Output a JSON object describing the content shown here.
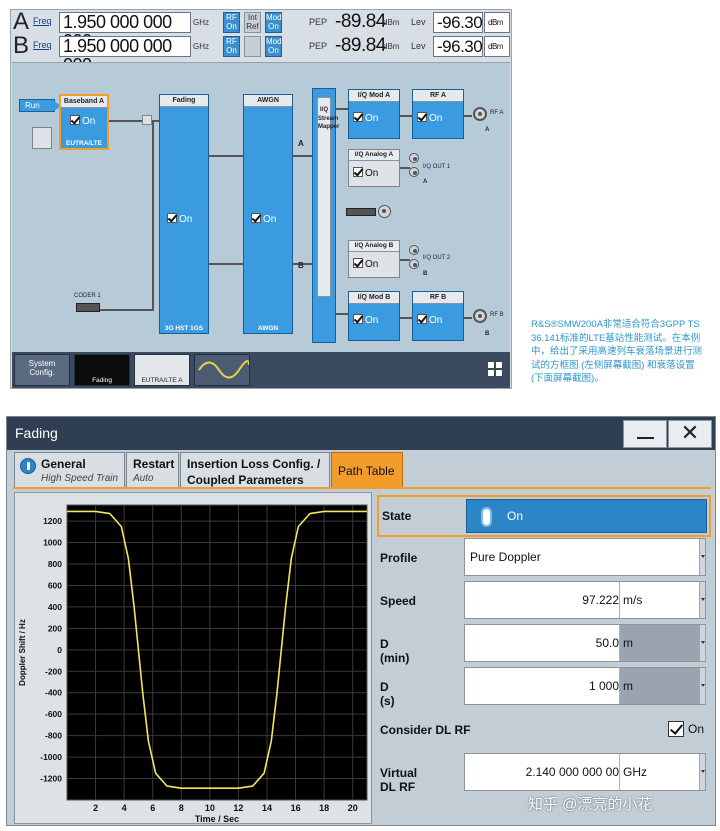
{
  "top": {
    "row_a": {
      "letter": "A",
      "freq_label": "Freq",
      "freq_value": "1.950 000 000 000",
      "freq_unit": "GHz",
      "rf_on": "RF On",
      "int_ref": "Int Ref",
      "mod_on": "Mod On",
      "pep_label": "PEP",
      "pep_value": "-89.84",
      "pep_unit": "dBm",
      "lev_label": "Lev",
      "lev_value": "-96.30",
      "lev_unit": "dBm"
    },
    "row_b": {
      "letter": "B",
      "freq_label": "Freq",
      "freq_value": "1.950 000 000 000",
      "freq_unit": "GHz",
      "rf_on": "RF On",
      "mod_on": "Mod On",
      "pep_label": "PEP",
      "pep_value": "-89.84",
      "pep_unit": "dBm",
      "lev_label": "Lev",
      "lev_value": "-96.30",
      "lev_unit": "dBm"
    },
    "diagram": {
      "run": "Run",
      "baseband": {
        "title": "Baseband A",
        "state": "On",
        "footer": "EUTRA/LTE"
      },
      "fading": {
        "title": "Fading",
        "state": "On",
        "footer": "3G HST 1GS"
      },
      "awgn": {
        "title": "AWGN",
        "state": "On",
        "footer": "AWGN"
      },
      "mapper": "I/Q Stream Mapper",
      "path_a": "A",
      "path_b": "B",
      "iq_mod_a": {
        "title": "I/Q Mod A",
        "state": "On"
      },
      "rf_a": {
        "title": "RF A",
        "state": "On",
        "port": "RF A",
        "label": "A"
      },
      "iq_analog_a": {
        "title": "I/Q Analog A",
        "state": "On",
        "port": "I/Q OUT 1",
        "label": "A"
      },
      "iq_analog_b": {
        "title": "I/Q Analog B",
        "state": "On",
        "port": "I/Q OUT 2",
        "label": "B"
      },
      "iq_mod_b": {
        "title": "I/Q Mod B",
        "state": "On"
      },
      "rf_b": {
        "title": "RF B",
        "state": "On",
        "port": "RF B",
        "label": "B"
      },
      "coder": "CODER 1"
    },
    "taskbar": {
      "system": "System Config.",
      "thumb1": "Fading",
      "thumb2": "EUTRA/LTE A"
    }
  },
  "caption": "R&S®SMW200A非常适合符合3GPP TS 36.141标准的LTE基站性能测试。在本例中，给出了采用高速列车衰落场景进行测试的方框图 (左侧屏幕截图) 和衰落设置 (下面屏幕截图)。",
  "dialog": {
    "title": "Fading",
    "tabs": [
      {
        "label": "General",
        "sub": "High Speed Train"
      },
      {
        "label": "Restart",
        "sub": "Auto"
      },
      {
        "label": "Insertion Loss Config. /",
        "sub": "Coupled Parameters"
      },
      {
        "label": "Path Table",
        "sub": ""
      }
    ],
    "params": {
      "state": {
        "label": "State",
        "value": "On"
      },
      "profile": {
        "label": "Profile",
        "value": "Pure Doppler"
      },
      "speed": {
        "label": "Speed",
        "value": "97.222",
        "unit": "m/s"
      },
      "dmin": {
        "label": "D (min)",
        "value": "50.0",
        "unit": "m"
      },
      "ds": {
        "label": "D (s)",
        "value": "1 000",
        "unit": "m"
      },
      "consider": {
        "label": "Consider DL RF",
        "value": "On"
      },
      "virtual": {
        "label": "Virtual DL RF",
        "value": "2.140 000 000 00",
        "unit": "GHz"
      }
    }
  },
  "chart_data": {
    "type": "line",
    "xlabel": "Time / Sec",
    "ylabel": "Doppler Shift / Hz",
    "xlim": [
      0,
      21
    ],
    "ylim": [
      -1400,
      1350
    ],
    "xticks": [
      2,
      4,
      6,
      8,
      10,
      12,
      14,
      16,
      18,
      20
    ],
    "yticks": [
      1200,
      1000,
      800,
      600,
      400,
      200,
      0,
      -200,
      -400,
      -600,
      -800,
      -1000,
      -1200
    ],
    "grid": true,
    "line_color": "#f2e85a",
    "background": "#000000",
    "series": [
      {
        "x": [
          0,
          2,
          3,
          3.8,
          4.3,
          4.7,
          5.0,
          5.3,
          5.7,
          6.2,
          7,
          8,
          10,
          12,
          13,
          13.8,
          14.3,
          14.7,
          15.0,
          15.3,
          15.7,
          16.2,
          17,
          18,
          20,
          21
        ],
        "y": [
          1290,
          1290,
          1270,
          1150,
          850,
          400,
          0,
          -400,
          -850,
          -1150,
          -1270,
          -1290,
          -1290,
          -1290,
          -1270,
          -1150,
          -850,
          -400,
          0,
          400,
          850,
          1150,
          1270,
          1290,
          1290,
          1290
        ]
      }
    ]
  },
  "watermark": "知乎 @漂亮的小花"
}
